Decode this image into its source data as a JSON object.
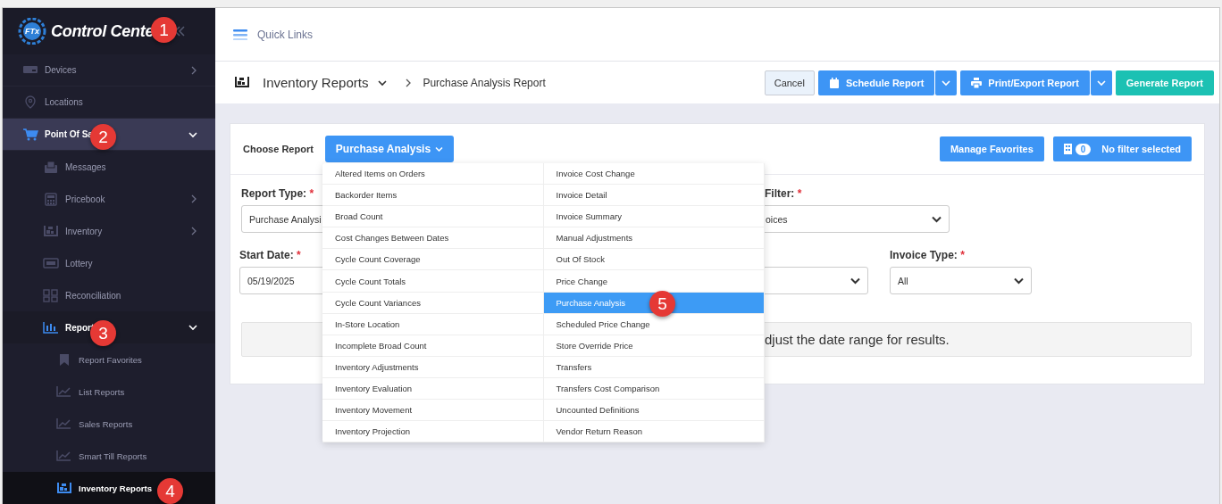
{
  "sidebar": {
    "logo": {
      "badge": "FTx",
      "text": "Control Cente"
    },
    "items": [
      {
        "label": "Devices",
        "expanded": false,
        "selected": false
      },
      {
        "label": "Locations",
        "selected": false
      },
      {
        "label": "Point Of Sa",
        "expanded": true,
        "selected": false,
        "children": [
          {
            "label": "Messages",
            "selected": false
          },
          {
            "label": "Pricebook",
            "expanded": false,
            "selected": false
          },
          {
            "label": "Inventory",
            "expanded": false,
            "selected": false
          },
          {
            "label": "Lottery",
            "selected": false
          },
          {
            "label": "Reconciliation",
            "selected": false
          },
          {
            "label": "Report",
            "expanded": true,
            "selected": false,
            "children": [
              {
                "label": "Report Favorites",
                "selected": false
              },
              {
                "label": "List Reports",
                "selected": false
              },
              {
                "label": "Sales Reports",
                "selected": false
              },
              {
                "label": "Smart Till Reports",
                "selected": false
              },
              {
                "label": "Inventory Reports",
                "selected": true
              }
            ]
          }
        ]
      }
    ]
  },
  "topbar": {
    "quick_links": "Quick Links"
  },
  "breadcrumb": {
    "section": "Inventory Reports",
    "page": "Purchase Analysis Report"
  },
  "actions": [
    {
      "label": "Cancel",
      "kind": "plain"
    },
    {
      "label": "Schedule Report",
      "kind": "split"
    },
    {
      "label": "Print/Export Report",
      "kind": "split"
    },
    {
      "label": "Generate Report",
      "kind": "primary"
    }
  ],
  "panel": {
    "choose_label": "Choose Report",
    "report_button": "Purchase Analysis",
    "manage_favorites": "Manage Favorites",
    "filter_count": "0",
    "filter_label": "No filter selected",
    "report_menu": [
      {
        "label": "Altered Items on Orders",
        "selected": false
      },
      {
        "label": "Backorder Items",
        "selected": false
      },
      {
        "label": "Broad Count",
        "selected": false
      },
      {
        "label": "Cost Changes Between Dates",
        "selected": false
      },
      {
        "label": "Cycle Count Coverage",
        "selected": false
      },
      {
        "label": "Cycle Count Totals",
        "selected": false
      },
      {
        "label": "Cycle Count Variances",
        "selected": false
      },
      {
        "label": "In-Store Location",
        "selected": false
      },
      {
        "label": "Incomplete Broad Count",
        "selected": false
      },
      {
        "label": "Inventory Adjustments",
        "selected": false
      },
      {
        "label": "Inventory Evaluation",
        "selected": false
      },
      {
        "label": "Inventory Movement",
        "selected": false
      },
      {
        "label": "Inventory Projection",
        "selected": false
      },
      {
        "label": "Invoice Cost Change",
        "selected": false
      },
      {
        "label": "Invoice Detail",
        "selected": false
      },
      {
        "label": "Invoice Summary",
        "selected": false
      },
      {
        "label": "Manual Adjustments",
        "selected": false
      },
      {
        "label": "Out Of Stock",
        "selected": false
      },
      {
        "label": "Price Change",
        "selected": false
      },
      {
        "label": "Purchase Analysis",
        "selected": true
      },
      {
        "label": "Scheduled Price Change",
        "selected": false
      },
      {
        "label": "Store Override Price",
        "selected": false
      },
      {
        "label": "Transfers",
        "selected": false
      },
      {
        "label": "Transfers Cost Comparison",
        "selected": false
      },
      {
        "label": "Uncounted Definitions",
        "selected": false
      },
      {
        "label": "Vendor Return Reason",
        "selected": false
      }
    ],
    "fields": [
      {
        "kind": "select",
        "label": "Report Type:",
        "asterisk": "*",
        "value": "Purchase Analysi"
      },
      {
        "kind": "select",
        "label": "Filter:",
        "asterisk": "*",
        "value": "oices"
      },
      {
        "kind": "date",
        "label": "Start Date:",
        "asterisk": "*",
        "value": "05/19/2025"
      },
      {
        "kind": "select"
      },
      {
        "kind": "select",
        "label": "Invoice Type:",
        "asterisk": "*",
        "value": "All"
      }
    ],
    "notice": "djust the date range for results."
  },
  "callouts": [
    "1",
    "2",
    "3",
    "4",
    "5"
  ]
}
